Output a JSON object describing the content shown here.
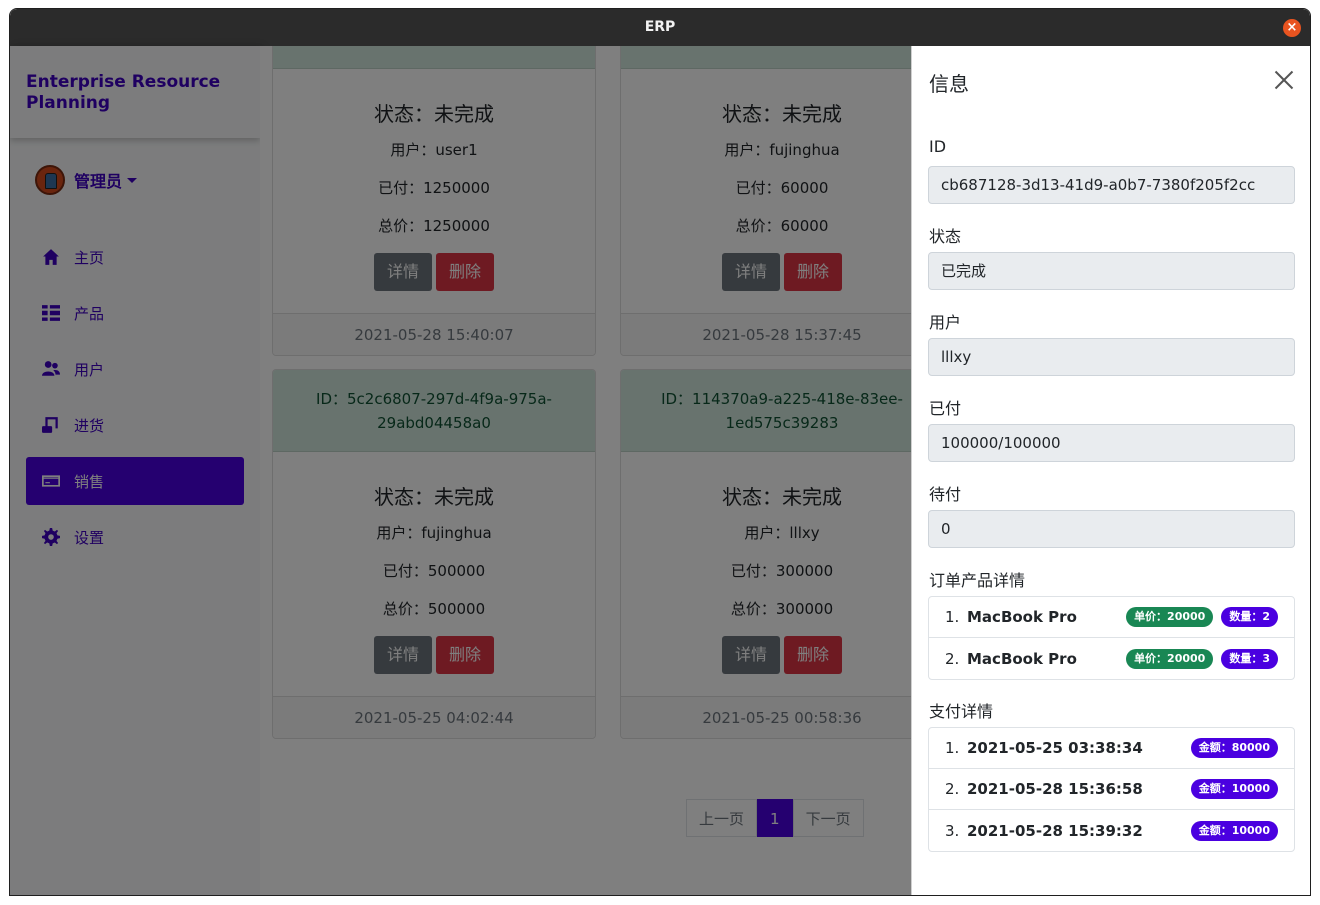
{
  "window": {
    "title": "ERP"
  },
  "sidebar": {
    "brand": "Enterprise Resource Planning",
    "user": "管理员",
    "items": [
      {
        "label": "主页",
        "icon": "home-icon",
        "active": false
      },
      {
        "label": "产品",
        "icon": "list-icon",
        "active": false
      },
      {
        "label": "用户",
        "icon": "users-icon",
        "active": false
      },
      {
        "label": "进货",
        "icon": "scroll-icon",
        "active": false
      },
      {
        "label": "销售",
        "icon": "credit-card-icon",
        "active": true
      },
      {
        "label": "设置",
        "icon": "gear-icon",
        "active": false
      }
    ]
  },
  "orders": [
    {
      "id": "",
      "status": "状态：未完成",
      "user": "用户：user1",
      "paid": "已付：1250000",
      "total": "总价：1250000",
      "time": "2021-05-28 15:40:07"
    },
    {
      "id": "",
      "status": "状态：未完成",
      "user": "用户：fujinghua",
      "paid": "已付：60000",
      "total": "总价：60000",
      "time": "2021-05-28 15:37:45"
    },
    {
      "id": "ID：5c2c6807-297d-4f9a-975a-29abd04458a0",
      "status": "状态：未完成",
      "user": "用户：fujinghua",
      "paid": "已付：500000",
      "total": "总价：500000",
      "time": "2021-05-25 04:02:44"
    },
    {
      "id": "ID：114370a9-a225-418e-83ee-1ed575c39283",
      "status": "状态：未完成",
      "user": "用户：lllxy",
      "paid": "已付：300000",
      "total": "总价：300000",
      "time": "2021-05-25 00:58:36"
    }
  ],
  "card_buttons": {
    "detail": "详情",
    "delete": "删除"
  },
  "pagination": {
    "prev": "上一页",
    "current": "1",
    "next": "下一页"
  },
  "panel": {
    "title": "信息",
    "id_label": "ID",
    "id_value": "cb687128-3d13-41d9-a0b7-7380f205f2cc",
    "status_label": "状态",
    "status_value": "已完成",
    "user_label": "用户",
    "user_value": "lllxy",
    "paid_label": "已付",
    "paid_value": "100000/100000",
    "due_label": "待付",
    "due_value": "0",
    "products_label": "订单产品详情",
    "products": [
      {
        "num": "1.",
        "name": "MacBook Pro",
        "price": "单价：20000",
        "qty": "数量：2"
      },
      {
        "num": "2.",
        "name": "MacBook Pro",
        "price": "单价：20000",
        "qty": "数量：3"
      }
    ],
    "payments_label": "支付详情",
    "payments": [
      {
        "num": "1.",
        "time": "2021-05-25 03:38:34",
        "amount": "金额：80000"
      },
      {
        "num": "2.",
        "time": "2021-05-28 15:36:58",
        "amount": "金额：10000"
      },
      {
        "num": "3.",
        "time": "2021-05-28 15:39:32",
        "amount": "金额：10000"
      }
    ]
  },
  "colors": {
    "primary": "#4a00e0",
    "danger": "#dc3545",
    "secondary": "#6c757d",
    "success": "#198754",
    "card_header": "#d1e7dd"
  }
}
